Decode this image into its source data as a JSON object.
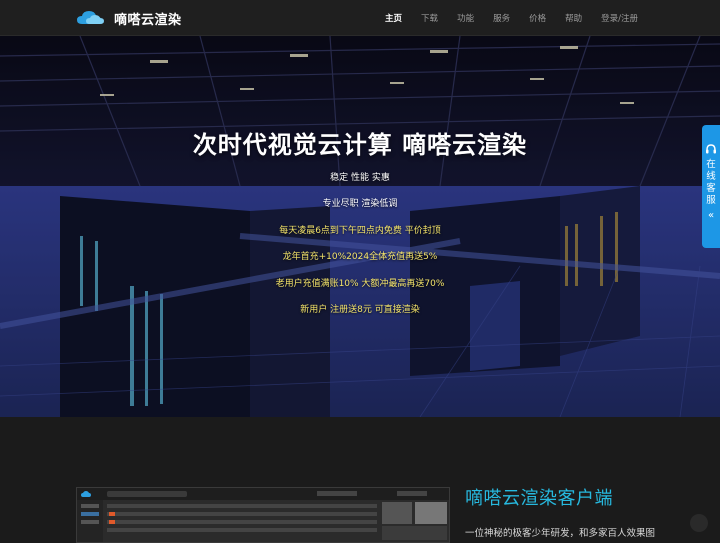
{
  "header": {
    "brand_name": "嘀嗒云渲染",
    "nav": [
      {
        "label": "主页",
        "active": true
      },
      {
        "label": "下载",
        "active": false
      },
      {
        "label": "功能",
        "active": false
      },
      {
        "label": "服务",
        "active": false
      },
      {
        "label": "价格",
        "active": false
      },
      {
        "label": "帮助",
        "active": false
      },
      {
        "label": "登录/注册",
        "active": false
      }
    ]
  },
  "hero": {
    "title": "次时代视觉云计算 嘀嗒云渲染",
    "lines": [
      {
        "text": "稳定 性能 实惠",
        "color": "white"
      },
      {
        "text": "专业尽职 渲染低调",
        "color": "white"
      },
      {
        "text": "每天凌晨6点到下午四点内免费 平价封顶",
        "color": "yellow"
      },
      {
        "text": "龙年首充+10%2024全体充值再送5%",
        "color": "yellow"
      },
      {
        "text": "老用户充值满账10% 大额冲最高再送70%",
        "color": "yellow"
      },
      {
        "text": "新用户 注册送8元 可直接渲染",
        "color": "yellow"
      }
    ]
  },
  "service_tab": {
    "label": "在线客服",
    "icon": "headset-icon",
    "arrow": "«"
  },
  "client_section": {
    "title": "嘀嗒云渲染客户端",
    "desc": "一位神秘的极客少年研发，和多家百人效果图"
  },
  "colors": {
    "nav_bg": "#1f1f1f",
    "accent": "#27b9df",
    "service_tab": "#1d97e6",
    "promo_yellow": "#f3e36a"
  }
}
